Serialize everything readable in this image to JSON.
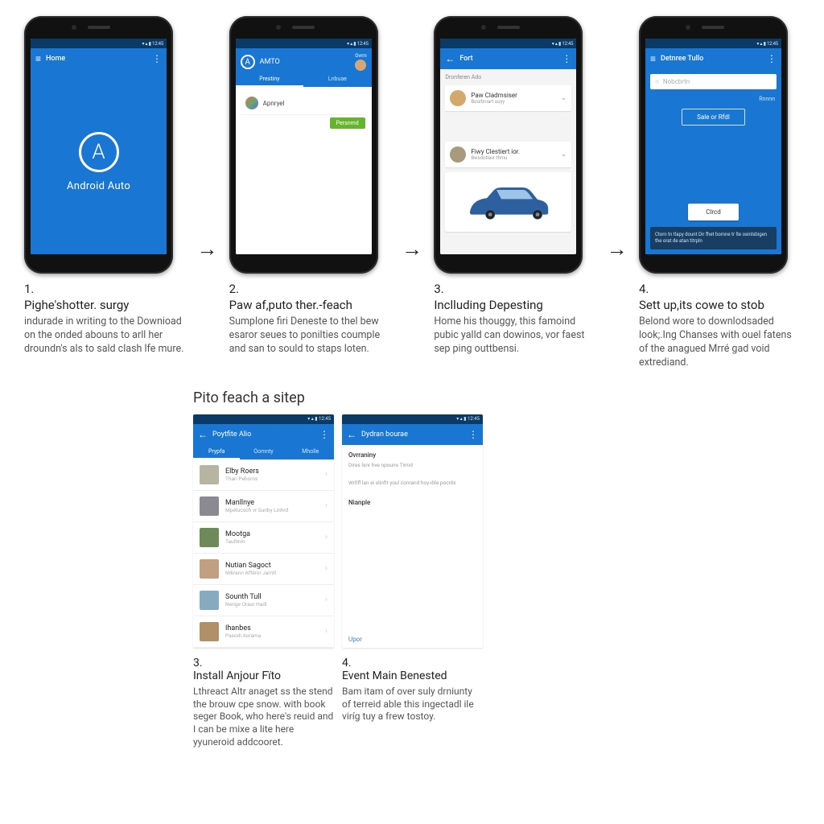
{
  "statusbar": "▾ ▴ ▮ 12:45",
  "top": {
    "step1": {
      "actionbar_title": "Home",
      "splash_brand": "Android Auto",
      "caption_num": "1.",
      "caption_title": "Pighe'shotter. surgy",
      "caption_body": "indurade in writing to the Downioad on the onded abouns to arll her droundn's als to sald clash lfe mure."
    },
    "step2": {
      "brand": "AMTO",
      "avatar_label": "Ovrrn",
      "tab1": "Prestiny",
      "tab2": "Lnbuae",
      "row_label": "Apnryel",
      "row_button": "Persnmd",
      "caption_num": "2.",
      "caption_title": "Paw af,puto ther.-feach",
      "caption_body": "Sumplone firi Deneste to thel bew esaror seues to ponilties coumple and san to sould to staps loten."
    },
    "step3": {
      "actionbar_title": "Fort",
      "section": "Dronferen Ado",
      "card1_t1": "Paw Cladmsiser",
      "card1_t2": "Bourbniart ouyy",
      "card2_t1": "Fiwy Clestiert ior.",
      "card2_t2": "Bwsdotlavr thmu",
      "caption_num": "3.",
      "caption_title": "Inclluding Depesting",
      "caption_body": "Home his thouggy, this famoind pubic yalld can dowinos, vor faest sep ping outtbensi."
    },
    "step4": {
      "actionbar_title": "Detnree Tullo",
      "search_placeholder": "Nobcbrtn",
      "link": "Rnnnn",
      "btn_outline": "Sale or Rfdl",
      "btn_white": "Clrcd",
      "footer": "Ctorn tn tlapy dount Dir fhet bomne tr lte osinlsbigen the orat de atan titrpln",
      "caption_num": "4.",
      "caption_title": "Sett up,its cowe to stob",
      "caption_body": "Belond wore to downlodsaded look;.Ing Chanses with ouel fatens of the anagued Mrré gad void extrediand."
    }
  },
  "bottom": {
    "heading": "Pito feach a sitep",
    "left": {
      "title": "Poytfite Alio",
      "tab1": "Prypfa",
      "tab2": "Oomnty",
      "tab3": "Mholle",
      "items": [
        {
          "t1": "Elby Roers",
          "t2": "Thari Peborns"
        },
        {
          "t1": "Manllnye",
          "t2": "Mpetucsch vr Sunby Linhrd"
        },
        {
          "t1": "Mootga",
          "t2": "Taultinin"
        },
        {
          "t1": "Nutian Sagoct",
          "t2": "Nrkrenn Afféror Jamtt"
        },
        {
          "t1": "Sounth Tull",
          "t2": "Nerige Oraor Hadi"
        },
        {
          "t1": "Ihanbes",
          "t2": "Pasodi Aorama"
        }
      ],
      "caption_num": "3.",
      "caption_title": "Install Anjour Fïto",
      "caption_body": "Lthreact Altr anaget ss the stend the brouw cpe snow. with book seger Book, who here's reuid and I can be mixe a lite here yyuneroid addcooret."
    },
    "right": {
      "title": "Dydran bourae",
      "sect1": "Ovrraniny",
      "sect1_sub": "Dires lsnr hve npouns Timid",
      "sect2_body": "Wrñfl lan ei slinfit youl conrand hoy-dile pocnbi",
      "sect3": "Nianple",
      "footer_link": "Upor",
      "caption_num": "4.",
      "caption_title": "Event Main Benested",
      "caption_body": "Bam itam of over suly drniunty of terreid able this ingectadl ile viríg tuy a frew tostoy."
    }
  }
}
